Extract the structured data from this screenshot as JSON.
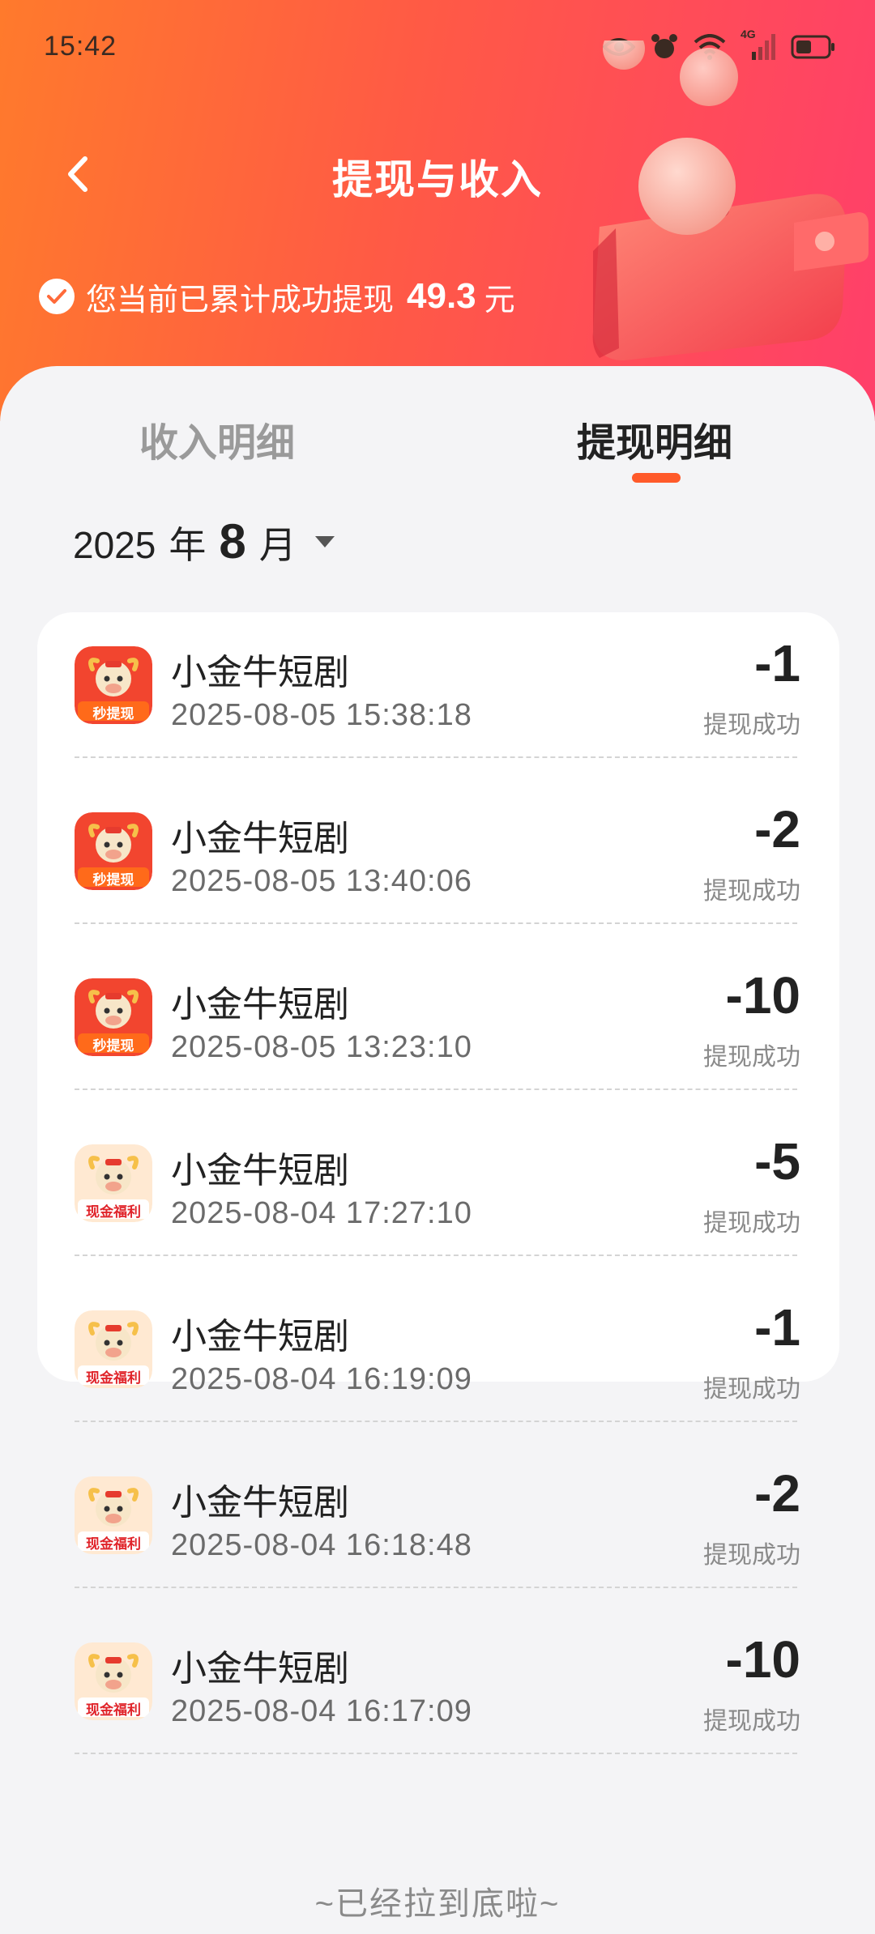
{
  "status_bar": {
    "time": "15:42",
    "network": "4G"
  },
  "header": {
    "title": "提现与收入",
    "summary_text": "您当前已累计成功提现",
    "summary_amount": "49.3",
    "summary_unit": "元"
  },
  "tabs": [
    {
      "label": "收入明细",
      "active": false
    },
    {
      "label": "提现明细",
      "active": true
    }
  ],
  "month_picker": {
    "year": "2025",
    "year_unit": "年",
    "month": "8",
    "month_unit": "月"
  },
  "records": [
    {
      "name": "小金牛短剧",
      "time": "2025-08-05 15:38:18",
      "amount": "-1",
      "status": "提现成功",
      "badge": "秒提现"
    },
    {
      "name": "小金牛短剧",
      "time": "2025-08-05 13:40:06",
      "amount": "-2",
      "status": "提现成功",
      "badge": "秒提现"
    },
    {
      "name": "小金牛短剧",
      "time": "2025-08-05 13:23:10",
      "amount": "-10",
      "status": "提现成功",
      "badge": "秒提现"
    },
    {
      "name": "小金牛短剧",
      "time": "2025-08-04 17:27:10",
      "amount": "-5",
      "status": "提现成功",
      "badge": "现金福利"
    },
    {
      "name": "小金牛短剧",
      "time": "2025-08-04 16:19:09",
      "amount": "-1",
      "status": "提现成功",
      "badge": "现金福利"
    },
    {
      "name": "小金牛短剧",
      "time": "2025-08-04 16:18:48",
      "amount": "-2",
      "status": "提现成功",
      "badge": "现金福利"
    },
    {
      "name": "小金牛短剧",
      "time": "2025-08-04 16:17:09",
      "amount": "-10",
      "status": "提现成功",
      "badge": "现金福利"
    }
  ],
  "footer": {
    "end_text": "~已经拉到底啦~"
  },
  "colors": {
    "accent": "#ff5a2a",
    "header_start": "#ff7a2c",
    "header_end": "#ff3f6a"
  }
}
